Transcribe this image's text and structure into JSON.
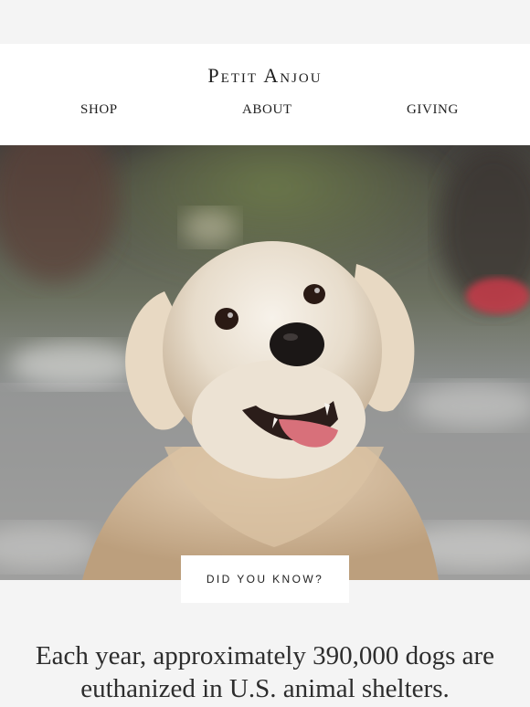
{
  "header": {
    "brand": "Petit Anjou"
  },
  "nav": [
    {
      "label": "SHOP"
    },
    {
      "label": "ABOUT"
    },
    {
      "label": "GIVING"
    }
  ],
  "hero": {
    "image_alt": "",
    "cta_label": "DID YOU KNOW?"
  },
  "fact": {
    "line1": "Each year, approximately 390,000 dogs are",
    "line2": "euthanized in U.S. animal shelters."
  },
  "colors": {
    "page_bg": "#f4f4f4",
    "header_bg": "#ffffff",
    "text": "#2d2d2d"
  }
}
